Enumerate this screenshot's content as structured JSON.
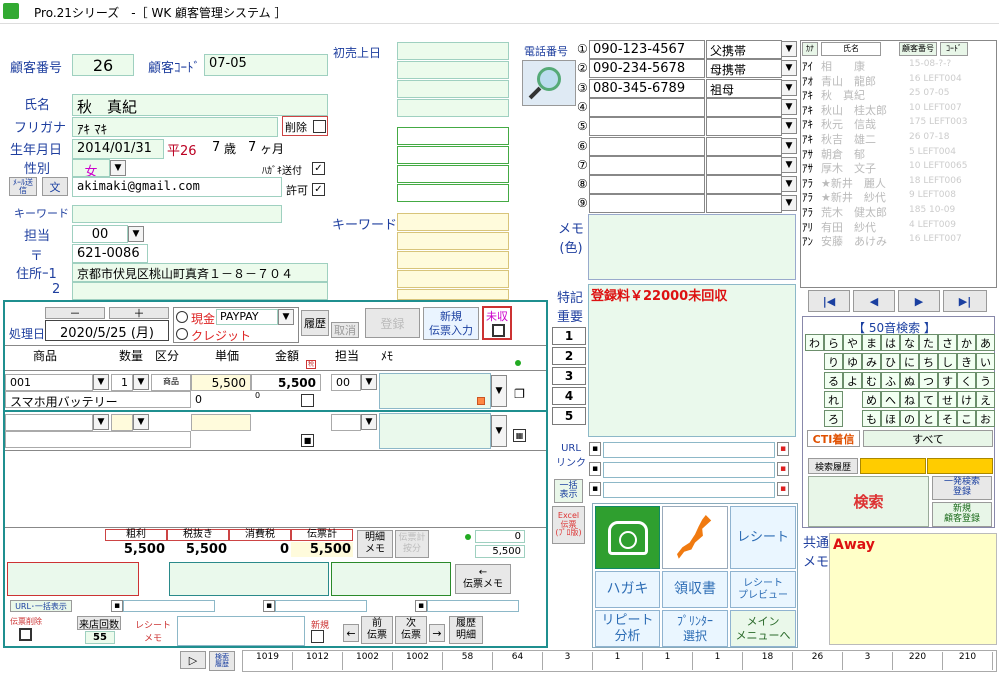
{
  "window": {
    "title": "Pro.21シリーズ　-［ WK 顧客管理システム ］"
  },
  "customer": {
    "num_label": "顧客番号",
    "num": "26",
    "code_label": "顧客ｺｰﾄﾞ",
    "code": "07-05",
    "name_label": "氏名",
    "name": "秋　真紀",
    "kana_label": "フリガナ",
    "kana": "ｱｷ ﾏｷ",
    "delete_label": "削除",
    "birth_label": "生年月日",
    "birth": "2014/01/31",
    "era": "平26",
    "age_years": "7",
    "age_years_unit": "歳",
    "age_months": "7",
    "age_months_unit": "ヶ月",
    "gender_label": "性別",
    "gender": "女",
    "postcard_label": "ﾊｶﾞｷ送付",
    "mail_btn": "ﾒｰﾙ送信",
    "doc_btn": "文",
    "email": "akimaki@gmail.com",
    "permit_label": "許可",
    "keyword_label": "キーワード",
    "staff_label": "担当",
    "staff": "00",
    "zip_label": "〒",
    "zip": "621-0086",
    "addr1_label": "住所ｰ1",
    "addr1": "京都市伏見区桃山町真斉１－８－７０４",
    "addr2_label": "2",
    "first_visit_label": "初売上日",
    "keyword2_label": "キーワード"
  },
  "phone": {
    "label": "電話番号",
    "rows": [
      {
        "num": "①",
        "tel": "090-123-4567",
        "rel": "父携帯"
      },
      {
        "num": "②",
        "tel": "090-234-5678",
        "rel": "母携帯"
      },
      {
        "num": "③",
        "tel": "080-345-6789",
        "rel": "祖母"
      },
      {
        "num": "④",
        "tel": "",
        "rel": ""
      },
      {
        "num": "⑤",
        "tel": "",
        "rel": ""
      },
      {
        "num": "⑥",
        "tel": "",
        "rel": ""
      },
      {
        "num": "⑦",
        "tel": "",
        "rel": ""
      },
      {
        "num": "⑧",
        "tel": "",
        "rel": ""
      },
      {
        "num": "⑨",
        "tel": "",
        "rel": ""
      }
    ]
  },
  "memo": {
    "label": "メモ\n(色)",
    "special_label": "特記\n重要",
    "special_text": "登録料￥22000未回収",
    "tabs": [
      "1",
      "2",
      "3",
      "4",
      "5"
    ],
    "url_label": "URL\nリンク",
    "bulk_btn": "一括\n表示",
    "excel_btn": "Excel\n伝票\n(ﾌﾟﾛ版)"
  },
  "list": {
    "headers": [
      "ｶﾅ",
      "氏名",
      "顧客番号",
      "ｺｰﾄﾞ"
    ],
    "rows": [
      {
        "k": "ｱｲ",
        "n": "相　　康",
        "c": "15-08-?-?"
      },
      {
        "k": "ｱｵ",
        "n": "青山　龍郎",
        "c": "16 LEFT004"
      },
      {
        "k": "ｱｷ",
        "n": "秋　真紀",
        "c": "25 07-05"
      },
      {
        "k": "ｱｷ",
        "n": "秋山　桂太郎",
        "c": "10 LEFT007"
      },
      {
        "k": "ｱｷ",
        "n": "秋元　信哉",
        "c": "175 LEFT003"
      },
      {
        "k": "ｱｷ",
        "n": "秋吉　雄二",
        "c": "26 07-18"
      },
      {
        "k": "ｱｻ",
        "n": "朝倉　郁",
        "c": "5 LEFT004"
      },
      {
        "k": "ｱｻ",
        "n": "厚木　文子",
        "c": "10 LEFT0065"
      },
      {
        "k": "ｱﾗ",
        "n": "★新井　麗人",
        "c": "18 LEFT006"
      },
      {
        "k": "ｱﾗ",
        "n": "★新井　紗代",
        "c": "9 LEFT008"
      },
      {
        "k": "ｱﾗ",
        "n": "荒木　健太郎",
        "c": "185 10-09"
      },
      {
        "k": "ｱﾘ",
        "n": "有田　紗代",
        "c": "4 LEFT009"
      },
      {
        "k": "ｱﾝ",
        "n": "安藤　あけみ",
        "c": "16 LEFT007"
      }
    ]
  },
  "nav": {
    "first": "|◀",
    "prev": "◀",
    "next": "▶",
    "last": "▶|"
  },
  "kana_search": {
    "title": "【 50音検索 】",
    "all": "すべて",
    "cti": "CTI着信",
    "grid": [
      [
        "わ",
        "ら",
        "や",
        "ま",
        "は",
        "な",
        "た",
        "さ",
        "か",
        "あ"
      ],
      [
        "",
        "り",
        "ゆ",
        "み",
        "ひ",
        "に",
        "ち",
        "し",
        "き",
        "い"
      ],
      [
        "",
        "る",
        "よ",
        "む",
        "ふ",
        "ぬ",
        "つ",
        "す",
        "く",
        "う"
      ],
      [
        "",
        "れ",
        "",
        "め",
        "へ",
        "ね",
        "て",
        "せ",
        "け",
        "え"
      ],
      [
        "",
        "ろ",
        "",
        "も",
        "ほ",
        "の",
        "と",
        "そ",
        "こ",
        "お"
      ]
    ]
  },
  "search": {
    "history": "検索履歴",
    "search": "検索",
    "one_search": "一発検索\n登録",
    "new_cust": "新規\n顧客登録"
  },
  "common_memo": {
    "label": "共通\nメモ",
    "text": "Away"
  },
  "actions": {
    "receipt": "レシート",
    "postcard": "ハガキ",
    "ryoshu": "領収書",
    "receipt_preview": "レシート\nプレビュー",
    "repeat": "リピート\n分析",
    "printer": "ﾌﾟﾘﾝﾀｰ\n選択",
    "main_menu": "メイン\nメニューへ"
  },
  "slip": {
    "minus": "－",
    "plus": "＋",
    "cash": "現金",
    "credit": "クレジット",
    "pay": "PAYPAY",
    "history": "履歴",
    "cancel": "取消",
    "register": "登録",
    "new_slip": "新規\n伝票入力",
    "unpaid": "未収",
    "date_label": "処理日",
    "date": "2020/5/25 (月)",
    "cols": [
      "商品",
      "数量",
      "区分",
      "単価",
      "金額",
      "担当",
      "ﾒﾓ"
    ],
    "item_code": "001",
    "qty": "1",
    "kubun": "商品",
    "price": "5,500",
    "amount": "5,500",
    "staff": "00",
    "item_name": "スマホ用バッテリー",
    "zero1": "0",
    "zero2": "0",
    "totals_labels": [
      "粗利",
      "税抜き",
      "消費税",
      "伝票計"
    ],
    "totals": [
      "5,500",
      "5,500",
      "0",
      "5,500"
    ],
    "detail_memo": "明細\nメモ",
    "slip_total_btn": "伝票計\n按分",
    "right_zero": "0",
    "right_total": "5,500",
    "slip_memo": "←\n伝票メモ",
    "url_bulk": "URL･一括表示",
    "slip_del": "伝票削除",
    "visit_label": "来店回数",
    "visit": "55",
    "receipt_memo": "レシート\nメモ",
    "new_label": "新規",
    "prev_slip": "前\n伝票",
    "next_slip": "次\n伝票",
    "history_detail": "履歴\n明細"
  },
  "statusbar": {
    "values": [
      "1019",
      "1012",
      "1002",
      "1002",
      "58",
      "64",
      "3",
      "1",
      "1",
      "1",
      "18",
      "26",
      "3",
      "220",
      "210"
    ],
    "search_history": "検索\n履歴"
  }
}
